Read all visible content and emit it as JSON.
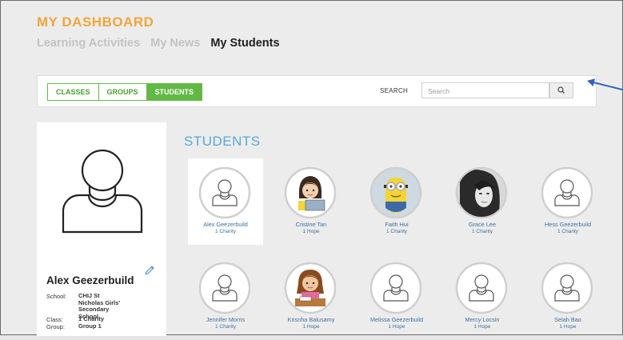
{
  "header": {
    "title": "MY DASHBOARD"
  },
  "nav": {
    "tabs": [
      {
        "label": "Learning Activities",
        "active": false
      },
      {
        "label": "My News",
        "active": false
      },
      {
        "label": "My Students",
        "active": true
      }
    ]
  },
  "filter": {
    "segments": [
      "CLASSES",
      "GROUPS",
      "STUDENTS"
    ],
    "selected": "STUDENTS",
    "search_label": "SEARCH",
    "search_placeholder": "Search",
    "search_icon": "magnifier-icon"
  },
  "profile": {
    "name": "Alex Geezerbuild",
    "fields": [
      {
        "label": "School:",
        "value": "CHIJ St Nicholas Girls' Secondary School"
      },
      {
        "label": "Class:",
        "value": "1 Charity"
      },
      {
        "label": "Group:",
        "value": "Group 1"
      }
    ],
    "edit_icon": "pencil-icon",
    "avatar_icon": "person-placeholder-icon"
  },
  "students": {
    "heading": "STUDENTS",
    "items": [
      {
        "name": "Alex Geezerbuild",
        "group": "1 Charity",
        "avatar": "placeholder",
        "selected": true
      },
      {
        "name": "Cristine Tan",
        "group": "1 Hope",
        "avatar": "cartoon-girl-laptop"
      },
      {
        "name": "Faith Hui",
        "group": "1 Charity",
        "avatar": "minion"
      },
      {
        "name": "Grace Lee",
        "group": "1 Charity",
        "avatar": "photo-woman"
      },
      {
        "name": "Hess Geezerbuild",
        "group": "1 Charity",
        "avatar": "placeholder"
      },
      {
        "name": "Jennifer Morris",
        "group": "1 Charity",
        "avatar": "placeholder"
      },
      {
        "name": "Krisnha Balusamy",
        "group": "1 Hope",
        "avatar": "cartoon-girl-desk"
      },
      {
        "name": "Melissa Geezerbuild",
        "group": "1 Hope",
        "avatar": "placeholder"
      },
      {
        "name": "Mercy Locsin",
        "group": "1 Hope",
        "avatar": "placeholder"
      },
      {
        "name": "Selah Bao",
        "group": "1 Hope",
        "avatar": "placeholder"
      }
    ]
  },
  "colors": {
    "accent_orange": "#f0a63a",
    "accent_green": "#63b845",
    "heading_blue": "#55a9d9",
    "annotation_arrow": "#2f65b8"
  }
}
